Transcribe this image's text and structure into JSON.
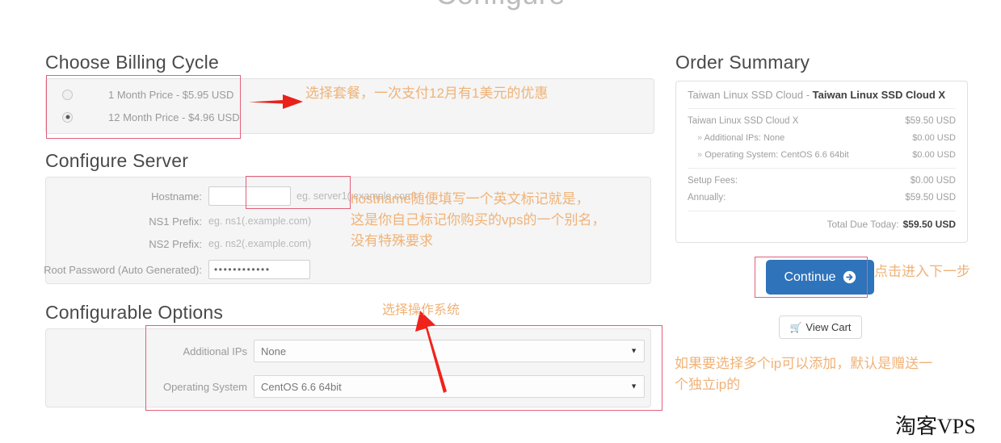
{
  "page": {
    "title": "Configure",
    "watermark": "淘客VPS"
  },
  "billing": {
    "heading": "Choose Billing Cycle",
    "options": [
      {
        "label": "1 Month Price - $5.95 USD",
        "selected": false
      },
      {
        "label": "12 Month Price - $4.96 USD",
        "selected": true
      }
    ]
  },
  "server": {
    "heading": "Configure Server",
    "fields": [
      {
        "label": "Hostname:",
        "value": "",
        "hint": "eg. server1(.example.com)"
      },
      {
        "label": "NS1 Prefix:",
        "value": "",
        "hint": "eg. ns1(.example.com)"
      },
      {
        "label": "NS2 Prefix:",
        "value": "",
        "hint": "eg. ns2(.example.com)"
      },
      {
        "label": "Root Password (Auto Generated):",
        "value": "••••••••••••",
        "hint": ""
      }
    ]
  },
  "options": {
    "heading": "Configurable Options",
    "fields": [
      {
        "label": "Additional IPs",
        "value": "None",
        "arrow": "▼"
      },
      {
        "label": "Operating System",
        "value": "CentOS 6.6 64bit",
        "arrow": "▼"
      }
    ]
  },
  "summary": {
    "heading": "Order Summary",
    "product_prefix": "Taiwan Linux SSD Cloud - ",
    "product_name": "Taiwan Linux SSD Cloud X",
    "lines": [
      {
        "name": "Taiwan Linux SSD Cloud X",
        "price": "$59.50 USD",
        "type": "main"
      },
      {
        "name": "Additional IPs: None",
        "price": "$0.00 USD",
        "type": "sub"
      },
      {
        "name": "Operating System: CentOS 6.6 64bit",
        "price": "$0.00 USD",
        "type": "sub"
      }
    ],
    "fees": [
      {
        "name": "Setup Fees:",
        "price": "$0.00 USD"
      },
      {
        "name": "Annually:",
        "price": "$59.50 USD"
      }
    ],
    "total_label": "Total Due Today:",
    "total_value": "$59.50 USD"
  },
  "actions": {
    "continue_label": "Continue",
    "view_cart_label": "View Cart",
    "cart_icon": "🛒"
  },
  "annotations": {
    "billing": "选择套餐，一次支付12月有1美元的优惠",
    "hostname": "hostname随便填写一个英文标记就是，\n这是你自己标记你购买的vps的一个别名，\n没有特殊要求",
    "operating_system": "选择操作系统",
    "continue": "点击进入下一步",
    "additional_ips": "如果要选择多个ip可以添加，默认是赠送一\n个独立ip的"
  },
  "colors": {
    "accent_blue": "#2f73ba",
    "annotation_orange": "#f0b277",
    "annotation_red": "#e0607a",
    "arrow_red": "#e8211a"
  }
}
